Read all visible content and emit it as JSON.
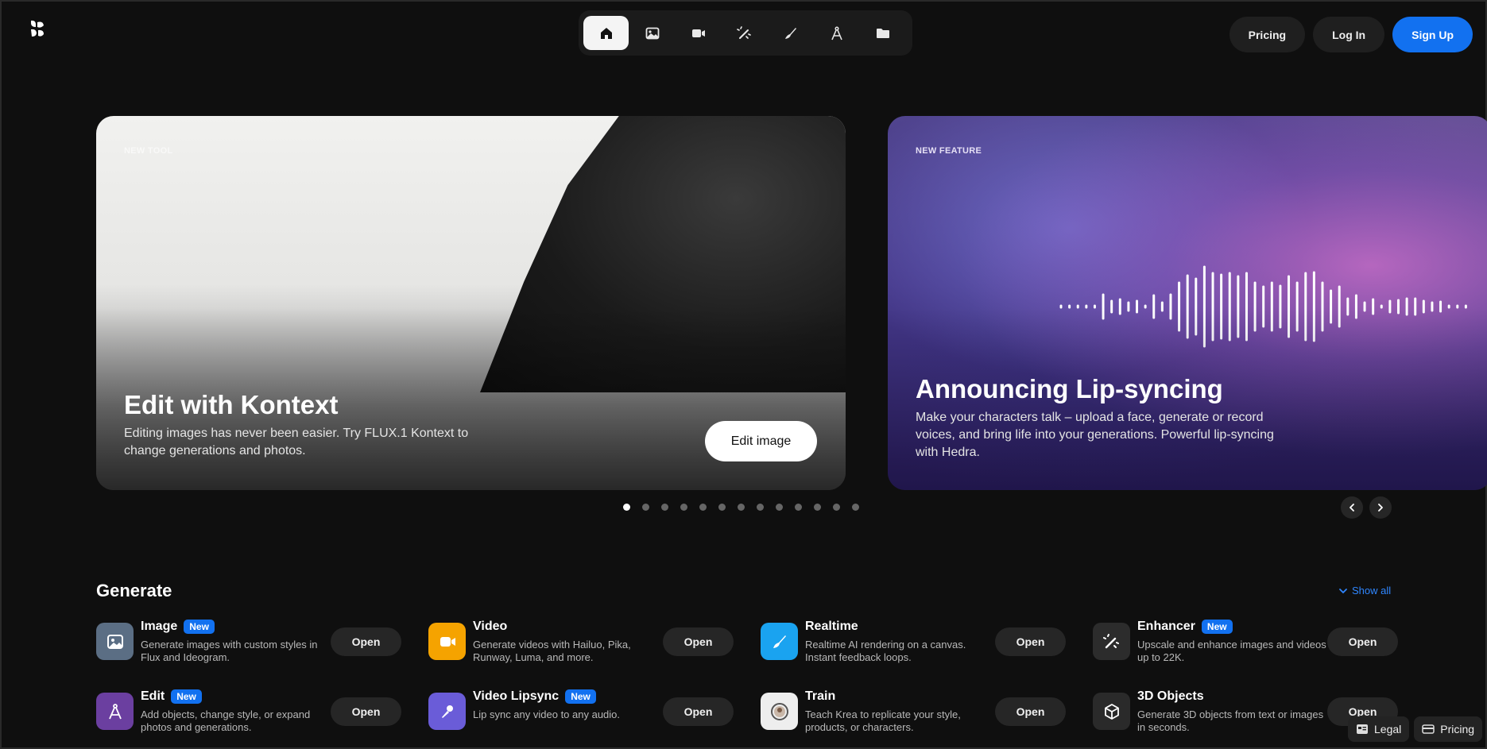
{
  "nav": {
    "icons": [
      "home-icon",
      "image-icon",
      "video-icon",
      "enhance-wand-icon",
      "brush-icon",
      "compass-icon",
      "folder-icon"
    ],
    "active_index": 0
  },
  "header": {
    "pricing": "Pricing",
    "login": "Log In",
    "signup": "Sign Up"
  },
  "carousel": {
    "slides": [
      {
        "kicker": "NEW TOOL",
        "title": "Edit with Kontext",
        "description": "Editing images has never been easier. Try FLUX.1 Kontext to change generations and photos.",
        "button": "Edit image"
      },
      {
        "kicker": "NEW FEATURE",
        "title": "Announcing Lip-syncing",
        "description": "Make your characters talk – upload a face, generate or record voices, and bring life into your generations. Powerful lip-syncing with Hedra."
      }
    ],
    "dot_count": 13,
    "active_dot": 0
  },
  "generate": {
    "title": "Generate",
    "show_all": "Show all",
    "open_label": "Open",
    "new_label": "New",
    "tools": [
      {
        "name": "Image",
        "new": true,
        "desc": "Generate images with custom styles in Flux and Ideogram.",
        "icon": "image-icon",
        "color": "#5b6e84"
      },
      {
        "name": "Video",
        "new": false,
        "desc": "Generate videos with Hailuo, Pika, Runway, Luma, and more.",
        "icon": "video-icon",
        "color": "#f5a300"
      },
      {
        "name": "Realtime",
        "new": false,
        "desc": "Realtime AI rendering on a canvas. Instant feedback loops.",
        "icon": "pen-icon",
        "color": "#1aa3f0"
      },
      {
        "name": "Enhancer",
        "new": true,
        "desc": "Upscale and enhance images and videos up to 22K.",
        "icon": "enhance-wand-icon",
        "color": "#2c2c2c"
      },
      {
        "name": "Edit",
        "new": true,
        "desc": "Add objects, change style, or expand photos and generations.",
        "icon": "compass-icon",
        "color": "#6b3fa0"
      },
      {
        "name": "Video Lipsync",
        "new": true,
        "desc": "Lip sync any video to any audio.",
        "icon": "microphone-icon",
        "color": "#6a5cd8"
      },
      {
        "name": "Train",
        "new": false,
        "desc": "Teach Krea to replicate your style, products, or characters.",
        "icon": "train-avatar-icon",
        "color": "#ffffff"
      },
      {
        "name": "3D Objects",
        "new": false,
        "desc": "Generate 3D objects from text or images in seconds.",
        "icon": "cube-icon",
        "color": "#2a2a2a"
      }
    ]
  },
  "footer": {
    "legal": "Legal",
    "pricing": "Pricing"
  }
}
